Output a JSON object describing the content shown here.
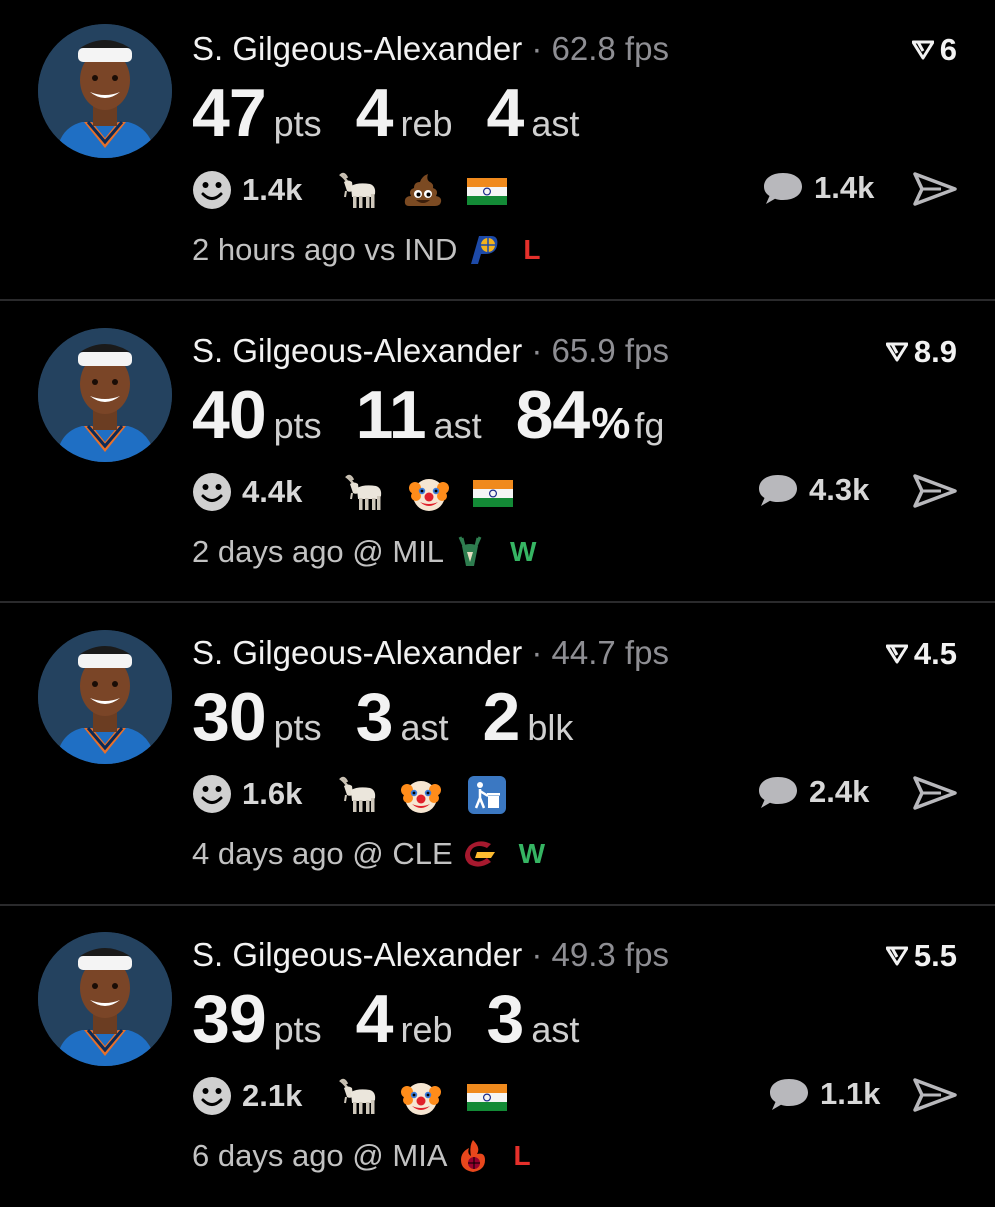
{
  "colors": {
    "win": "#36b563",
    "loss": "#e5302b",
    "muted": "#8e8e93",
    "background": "#000000"
  },
  "posts": [
    {
      "player": "S. Gilgeous-Alexander",
      "separator": "·",
      "fps": "62.8 fps",
      "rating": "6",
      "stats": [
        {
          "value": "47",
          "unit": "pts"
        },
        {
          "value": "4",
          "unit": "reb"
        },
        {
          "value": "4",
          "unit": "ast"
        }
      ],
      "reaction_count": "1.4k",
      "reactions": [
        "goat-icon",
        "poop-icon",
        "india-flag-icon"
      ],
      "comment_count": "1.4k",
      "time": "2 hours ago vs IND",
      "team_logo": "pacers-logo-icon",
      "result": "L"
    },
    {
      "player": "S. Gilgeous-Alexander",
      "separator": "·",
      "fps": "65.9 fps",
      "rating": "8.9",
      "stats": [
        {
          "value": "40",
          "unit": "pts"
        },
        {
          "value": "11",
          "unit": "ast"
        },
        {
          "value": "84",
          "pct": "%",
          "unit": "fg"
        }
      ],
      "reaction_count": "4.4k",
      "reactions": [
        "goat-icon",
        "clown-icon",
        "india-flag-icon"
      ],
      "comment_count": "4.3k",
      "time": "2 days ago @ MIL",
      "team_logo": "bucks-logo-icon",
      "result": "W"
    },
    {
      "player": "S. Gilgeous-Alexander",
      "separator": "·",
      "fps": "44.7 fps",
      "rating": "4.5",
      "stats": [
        {
          "value": "30",
          "unit": "pts"
        },
        {
          "value": "3",
          "unit": "ast"
        },
        {
          "value": "2",
          "unit": "blk"
        }
      ],
      "reaction_count": "1.6k",
      "reactions": [
        "goat-icon",
        "clown-icon",
        "trash-icon"
      ],
      "comment_count": "2.4k",
      "time": "4 days ago @ CLE",
      "team_logo": "cavaliers-logo-icon",
      "result": "W"
    },
    {
      "player": "S. Gilgeous-Alexander",
      "separator": "·",
      "fps": "49.3 fps",
      "rating": "5.5",
      "stats": [
        {
          "value": "39",
          "unit": "pts"
        },
        {
          "value": "4",
          "unit": "reb"
        },
        {
          "value": "3",
          "unit": "ast"
        }
      ],
      "reaction_count": "2.1k",
      "reactions": [
        "goat-icon",
        "clown-icon",
        "india-flag-icon"
      ],
      "comment_count": "1.1k",
      "time": "6 days ago @ MIA",
      "team_logo": "heat-logo-icon",
      "result": "L"
    }
  ]
}
